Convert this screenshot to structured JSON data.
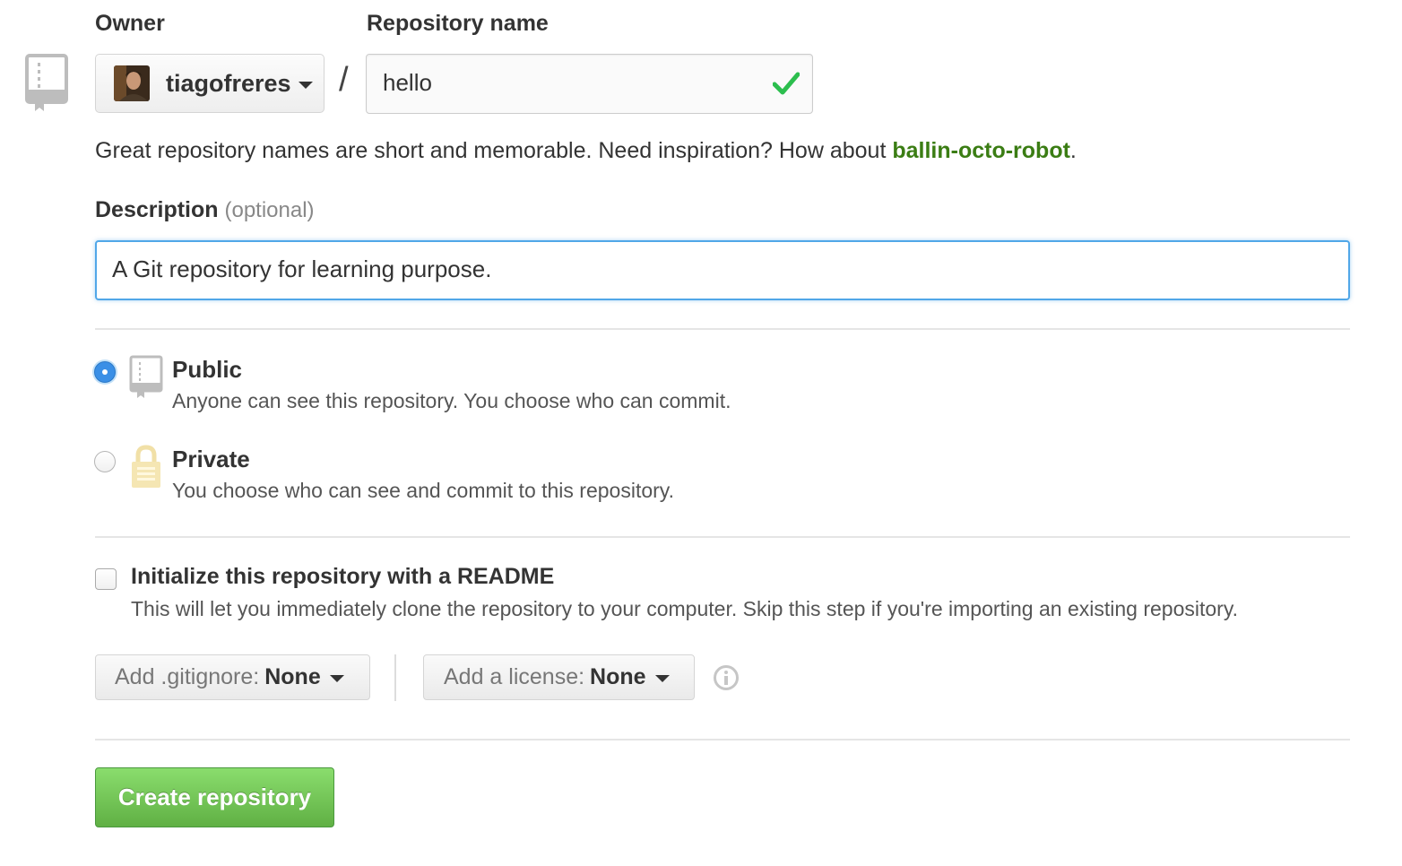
{
  "owner": {
    "label": "Owner",
    "name": "tiagofreres",
    "avatar_icon": "user-avatar"
  },
  "repo_name": {
    "label": "Repository name",
    "value": "hello",
    "valid_icon": "check-icon",
    "valid_color": "#2cbe4e"
  },
  "separator": "/",
  "hint": {
    "text": "Great repository names are short and memorable. Need inspiration? How about ",
    "suggestion": "ballin-octo-robot",
    "suffix": "."
  },
  "description": {
    "label": "Description",
    "optional": "(optional)",
    "value": "A Git repository for learning purpose."
  },
  "visibility": {
    "selected": "public",
    "options": [
      {
        "id": "public",
        "title": "Public",
        "desc": "Anyone can see this repository. You choose who can commit.",
        "icon": "repo-icon"
      },
      {
        "id": "private",
        "title": "Private",
        "desc": "You choose who can see and commit to this repository.",
        "icon": "lock-icon"
      }
    ]
  },
  "readme": {
    "checked": false,
    "title": "Initialize this repository with a README",
    "desc": "This will let you immediately clone the repository to your computer. Skip this step if you're importing an existing repository."
  },
  "gitignore": {
    "prefix": "Add .gitignore:",
    "value": "None"
  },
  "license": {
    "prefix": "Add a license:",
    "value": "None"
  },
  "create_button": "Create repository",
  "colors": {
    "accent_blue": "#51a7e8",
    "link_green": "#3b7d14",
    "button_green": "#60b044"
  }
}
